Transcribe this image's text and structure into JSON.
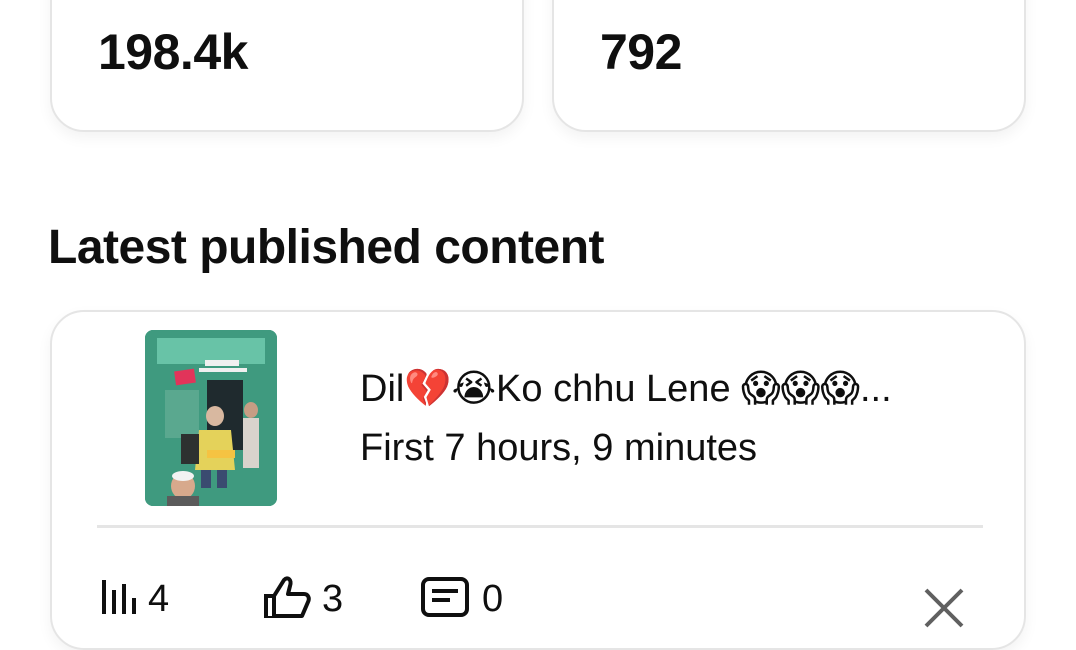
{
  "stats": {
    "views_value": "198.4k",
    "subscribers_value": "792"
  },
  "section": {
    "title": "Latest published content"
  },
  "latest_video": {
    "title": "Dil💔😭Ko chhu Lene 😱😱😱...",
    "period": "First 7 hours, 9 minutes",
    "views": "4",
    "likes": "3",
    "comments": "0",
    "thumbnail_icon": "video-thumbnail"
  },
  "colors": {
    "card_border": "#e5e5e5",
    "text": "#0f0f0f",
    "thumbnail_bg": "#3f9a7f"
  }
}
